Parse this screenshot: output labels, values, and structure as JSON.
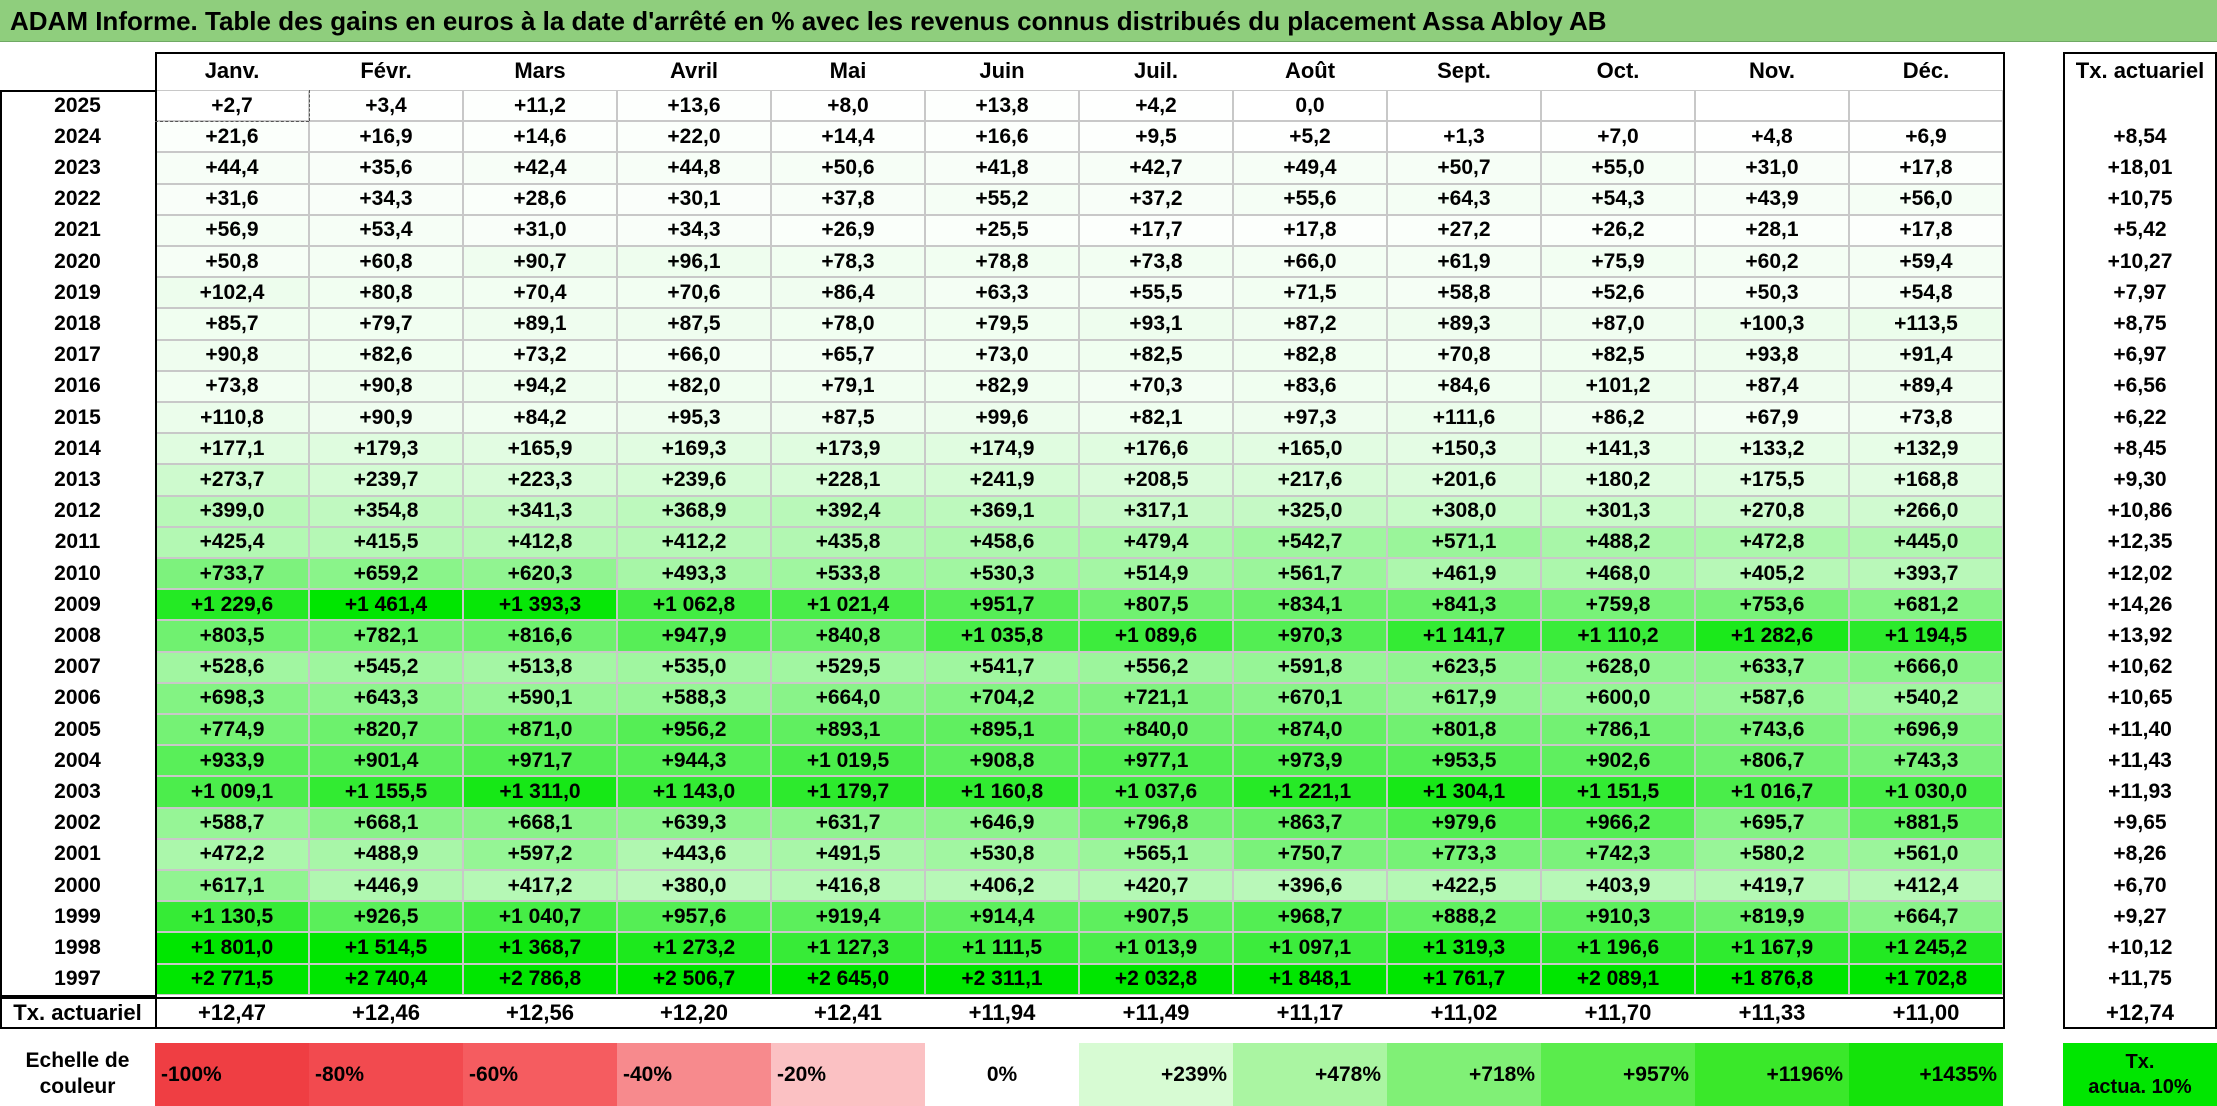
{
  "title": "ADAM Informe. Table des gains en euros à la date d'arrêté en % avec les revenus connus distribués du placement Assa Abloy AB",
  "months": [
    "Janv.",
    "Févr.",
    "Mars",
    "Avril",
    "Mai",
    "Juin",
    "Juil.",
    "Août",
    "Sept.",
    "Oct.",
    "Nov.",
    "Déc."
  ],
  "tx_header": "Tx. actuariel",
  "rows": [
    {
      "year": "2025",
      "values": [
        "+2,7",
        "+3,4",
        "+11,2",
        "+13,6",
        "+8,0",
        "+13,8",
        "+4,2",
        "0,0",
        "",
        "",
        "",
        ""
      ],
      "tx": ""
    },
    {
      "year": "2024",
      "values": [
        "+21,6",
        "+16,9",
        "+14,6",
        "+22,0",
        "+14,4",
        "+16,6",
        "+9,5",
        "+5,2",
        "+1,3",
        "+7,0",
        "+4,8",
        "+6,9"
      ],
      "tx": "+8,54"
    },
    {
      "year": "2023",
      "values": [
        "+44,4",
        "+35,6",
        "+42,4",
        "+44,8",
        "+50,6",
        "+41,8",
        "+42,7",
        "+49,4",
        "+50,7",
        "+55,0",
        "+31,0",
        "+17,8"
      ],
      "tx": "+18,01"
    },
    {
      "year": "2022",
      "values": [
        "+31,6",
        "+34,3",
        "+28,6",
        "+30,1",
        "+37,8",
        "+55,2",
        "+37,2",
        "+55,6",
        "+64,3",
        "+54,3",
        "+43,9",
        "+56,0"
      ],
      "tx": "+10,75"
    },
    {
      "year": "2021",
      "values": [
        "+56,9",
        "+53,4",
        "+31,0",
        "+34,3",
        "+26,9",
        "+25,5",
        "+17,7",
        "+17,8",
        "+27,2",
        "+26,2",
        "+28,1",
        "+17,8"
      ],
      "tx": "+5,42"
    },
    {
      "year": "2020",
      "values": [
        "+50,8",
        "+60,8",
        "+90,7",
        "+96,1",
        "+78,3",
        "+78,8",
        "+73,8",
        "+66,0",
        "+61,9",
        "+75,9",
        "+60,2",
        "+59,4"
      ],
      "tx": "+10,27"
    },
    {
      "year": "2019",
      "values": [
        "+102,4",
        "+80,8",
        "+70,4",
        "+70,6",
        "+86,4",
        "+63,3",
        "+55,5",
        "+71,5",
        "+58,8",
        "+52,6",
        "+50,3",
        "+54,8"
      ],
      "tx": "+7,97"
    },
    {
      "year": "2018",
      "values": [
        "+85,7",
        "+79,7",
        "+89,1",
        "+87,5",
        "+78,0",
        "+79,5",
        "+93,1",
        "+87,2",
        "+89,3",
        "+87,0",
        "+100,3",
        "+113,5"
      ],
      "tx": "+8,75"
    },
    {
      "year": "2017",
      "values": [
        "+90,8",
        "+82,6",
        "+73,2",
        "+66,0",
        "+65,7",
        "+73,0",
        "+82,5",
        "+82,8",
        "+70,8",
        "+82,5",
        "+93,8",
        "+91,4"
      ],
      "tx": "+6,97"
    },
    {
      "year": "2016",
      "values": [
        "+73,8",
        "+90,8",
        "+94,2",
        "+82,0",
        "+79,1",
        "+82,9",
        "+70,3",
        "+83,6",
        "+84,6",
        "+101,2",
        "+87,4",
        "+89,4"
      ],
      "tx": "+6,56"
    },
    {
      "year": "2015",
      "values": [
        "+110,8",
        "+90,9",
        "+84,2",
        "+95,3",
        "+87,5",
        "+99,6",
        "+82,1",
        "+97,3",
        "+111,6",
        "+86,2",
        "+67,9",
        "+73,8"
      ],
      "tx": "+6,22"
    },
    {
      "year": "2014",
      "values": [
        "+177,1",
        "+179,3",
        "+165,9",
        "+169,3",
        "+173,9",
        "+174,9",
        "+176,6",
        "+165,0",
        "+150,3",
        "+141,3",
        "+133,2",
        "+132,9"
      ],
      "tx": "+8,45"
    },
    {
      "year": "2013",
      "values": [
        "+273,7",
        "+239,7",
        "+223,3",
        "+239,6",
        "+228,1",
        "+241,9",
        "+208,5",
        "+217,6",
        "+201,6",
        "+180,2",
        "+175,5",
        "+168,8"
      ],
      "tx": "+9,30"
    },
    {
      "year": "2012",
      "values": [
        "+399,0",
        "+354,8",
        "+341,3",
        "+368,9",
        "+392,4",
        "+369,1",
        "+317,1",
        "+325,0",
        "+308,0",
        "+301,3",
        "+270,8",
        "+266,0"
      ],
      "tx": "+10,86"
    },
    {
      "year": "2011",
      "values": [
        "+425,4",
        "+415,5",
        "+412,8",
        "+412,2",
        "+435,8",
        "+458,6",
        "+479,4",
        "+542,7",
        "+571,1",
        "+488,2",
        "+472,8",
        "+445,0"
      ],
      "tx": "+12,35"
    },
    {
      "year": "2010",
      "values": [
        "+733,7",
        "+659,2",
        "+620,3",
        "+493,3",
        "+533,8",
        "+530,3",
        "+514,9",
        "+561,7",
        "+461,9",
        "+468,0",
        "+405,2",
        "+393,7"
      ],
      "tx": "+12,02"
    },
    {
      "year": "2009",
      "values": [
        "+1 229,6",
        "+1 461,4",
        "+1 393,3",
        "+1 062,8",
        "+1 021,4",
        "+951,7",
        "+807,5",
        "+834,1",
        "+841,3",
        "+759,8",
        "+753,6",
        "+681,2"
      ],
      "tx": "+14,26"
    },
    {
      "year": "2008",
      "values": [
        "+803,5",
        "+782,1",
        "+816,6",
        "+947,9",
        "+840,8",
        "+1 035,8",
        "+1 089,6",
        "+970,3",
        "+1 141,7",
        "+1 110,2",
        "+1 282,6",
        "+1 194,5"
      ],
      "tx": "+13,92"
    },
    {
      "year": "2007",
      "values": [
        "+528,6",
        "+545,2",
        "+513,8",
        "+535,0",
        "+529,5",
        "+541,7",
        "+556,2",
        "+591,8",
        "+623,5",
        "+628,0",
        "+633,7",
        "+666,0"
      ],
      "tx": "+10,62"
    },
    {
      "year": "2006",
      "values": [
        "+698,3",
        "+643,3",
        "+590,1",
        "+588,3",
        "+664,0",
        "+704,2",
        "+721,1",
        "+670,1",
        "+617,9",
        "+600,0",
        "+587,6",
        "+540,2"
      ],
      "tx": "+10,65"
    },
    {
      "year": "2005",
      "values": [
        "+774,9",
        "+820,7",
        "+871,0",
        "+956,2",
        "+893,1",
        "+895,1",
        "+840,0",
        "+874,0",
        "+801,8",
        "+786,1",
        "+743,6",
        "+696,9"
      ],
      "tx": "+11,40"
    },
    {
      "year": "2004",
      "values": [
        "+933,9",
        "+901,4",
        "+971,7",
        "+944,3",
        "+1 019,5",
        "+908,8",
        "+977,1",
        "+973,9",
        "+953,5",
        "+902,6",
        "+806,7",
        "+743,3"
      ],
      "tx": "+11,43"
    },
    {
      "year": "2003",
      "values": [
        "+1 009,1",
        "+1 155,5",
        "+1 311,0",
        "+1 143,0",
        "+1 179,7",
        "+1 160,8",
        "+1 037,6",
        "+1 221,1",
        "+1 304,1",
        "+1 151,5",
        "+1 016,7",
        "+1 030,0"
      ],
      "tx": "+11,93"
    },
    {
      "year": "2002",
      "values": [
        "+588,7",
        "+668,1",
        "+668,1",
        "+639,3",
        "+631,7",
        "+646,9",
        "+796,8",
        "+863,7",
        "+979,6",
        "+966,2",
        "+695,7",
        "+881,5"
      ],
      "tx": "+9,65"
    },
    {
      "year": "2001",
      "values": [
        "+472,2",
        "+488,9",
        "+597,2",
        "+443,6",
        "+491,5",
        "+530,8",
        "+565,1",
        "+750,7",
        "+773,3",
        "+742,3",
        "+580,2",
        "+561,0"
      ],
      "tx": "+8,26"
    },
    {
      "year": "2000",
      "values": [
        "+617,1",
        "+446,9",
        "+417,2",
        "+380,0",
        "+416,8",
        "+406,2",
        "+420,7",
        "+396,6",
        "+422,5",
        "+403,9",
        "+419,7",
        "+412,4"
      ],
      "tx": "+6,70"
    },
    {
      "year": "1999",
      "values": [
        "+1 130,5",
        "+926,5",
        "+1 040,7",
        "+957,6",
        "+919,4",
        "+914,4",
        "+907,5",
        "+968,7",
        "+888,2",
        "+910,3",
        "+819,9",
        "+664,7"
      ],
      "tx": "+9,27"
    },
    {
      "year": "1998",
      "values": [
        "+1 801,0",
        "+1 514,5",
        "+1 368,7",
        "+1 273,2",
        "+1 127,3",
        "+1 111,5",
        "+1 013,9",
        "+1 097,1",
        "+1 319,3",
        "+1 196,6",
        "+1 167,9",
        "+1 245,2"
      ],
      "tx": "+10,12"
    },
    {
      "year": "1997",
      "values": [
        "+2 771,5",
        "+2 740,4",
        "+2 786,8",
        "+2 506,7",
        "+2 645,0",
        "+2 311,1",
        "+2 032,8",
        "+1 848,1",
        "+1 761,7",
        "+2 089,1",
        "+1 876,8",
        "+1 702,8"
      ],
      "tx": "+11,75"
    }
  ],
  "footer": {
    "label": "Tx. actuariel",
    "values": [
      "+12,47",
      "+12,46",
      "+12,56",
      "+12,20",
      "+12,41",
      "+11,94",
      "+11,49",
      "+11,17",
      "+11,02",
      "+11,70",
      "+11,33",
      "+11,00"
    ],
    "tx": "+12,74"
  },
  "scale": {
    "label_line1": "Echelle de",
    "label_line2": "couleur",
    "steps": [
      {
        "label": "-100%",
        "color": "#ef3e43",
        "align": "left"
      },
      {
        "label": "-80%",
        "color": "#f24a4f",
        "align": "left"
      },
      {
        "label": "-60%",
        "color": "#f55c60",
        "align": "left"
      },
      {
        "label": "-40%",
        "color": "#f78a8d",
        "align": "left"
      },
      {
        "label": "-20%",
        "color": "#fbc1c3",
        "align": "left"
      },
      {
        "label": "0%",
        "color": "#ffffff",
        "align": "center"
      },
      {
        "label": "+239%",
        "color": "#d7fbd3",
        "align": "right"
      },
      {
        "label": "+478%",
        "color": "#aaf5a2",
        "align": "right"
      },
      {
        "label": "+718%",
        "color": "#80f076",
        "align": "right"
      },
      {
        "label": "+957%",
        "color": "#5aec4c",
        "align": "right"
      },
      {
        "label": "+1196%",
        "color": "#3ae82a",
        "align": "right"
      },
      {
        "label": "+1435%",
        "color": "#14e30a",
        "align": "right"
      }
    ],
    "tx_line1": "Tx.",
    "tx_line2": "actua. 10%",
    "tx_color": "#00e600"
  },
  "colors": {
    "title_bg": "#8fce7d",
    "green_max": "#00e600",
    "white": "#ffffff"
  }
}
